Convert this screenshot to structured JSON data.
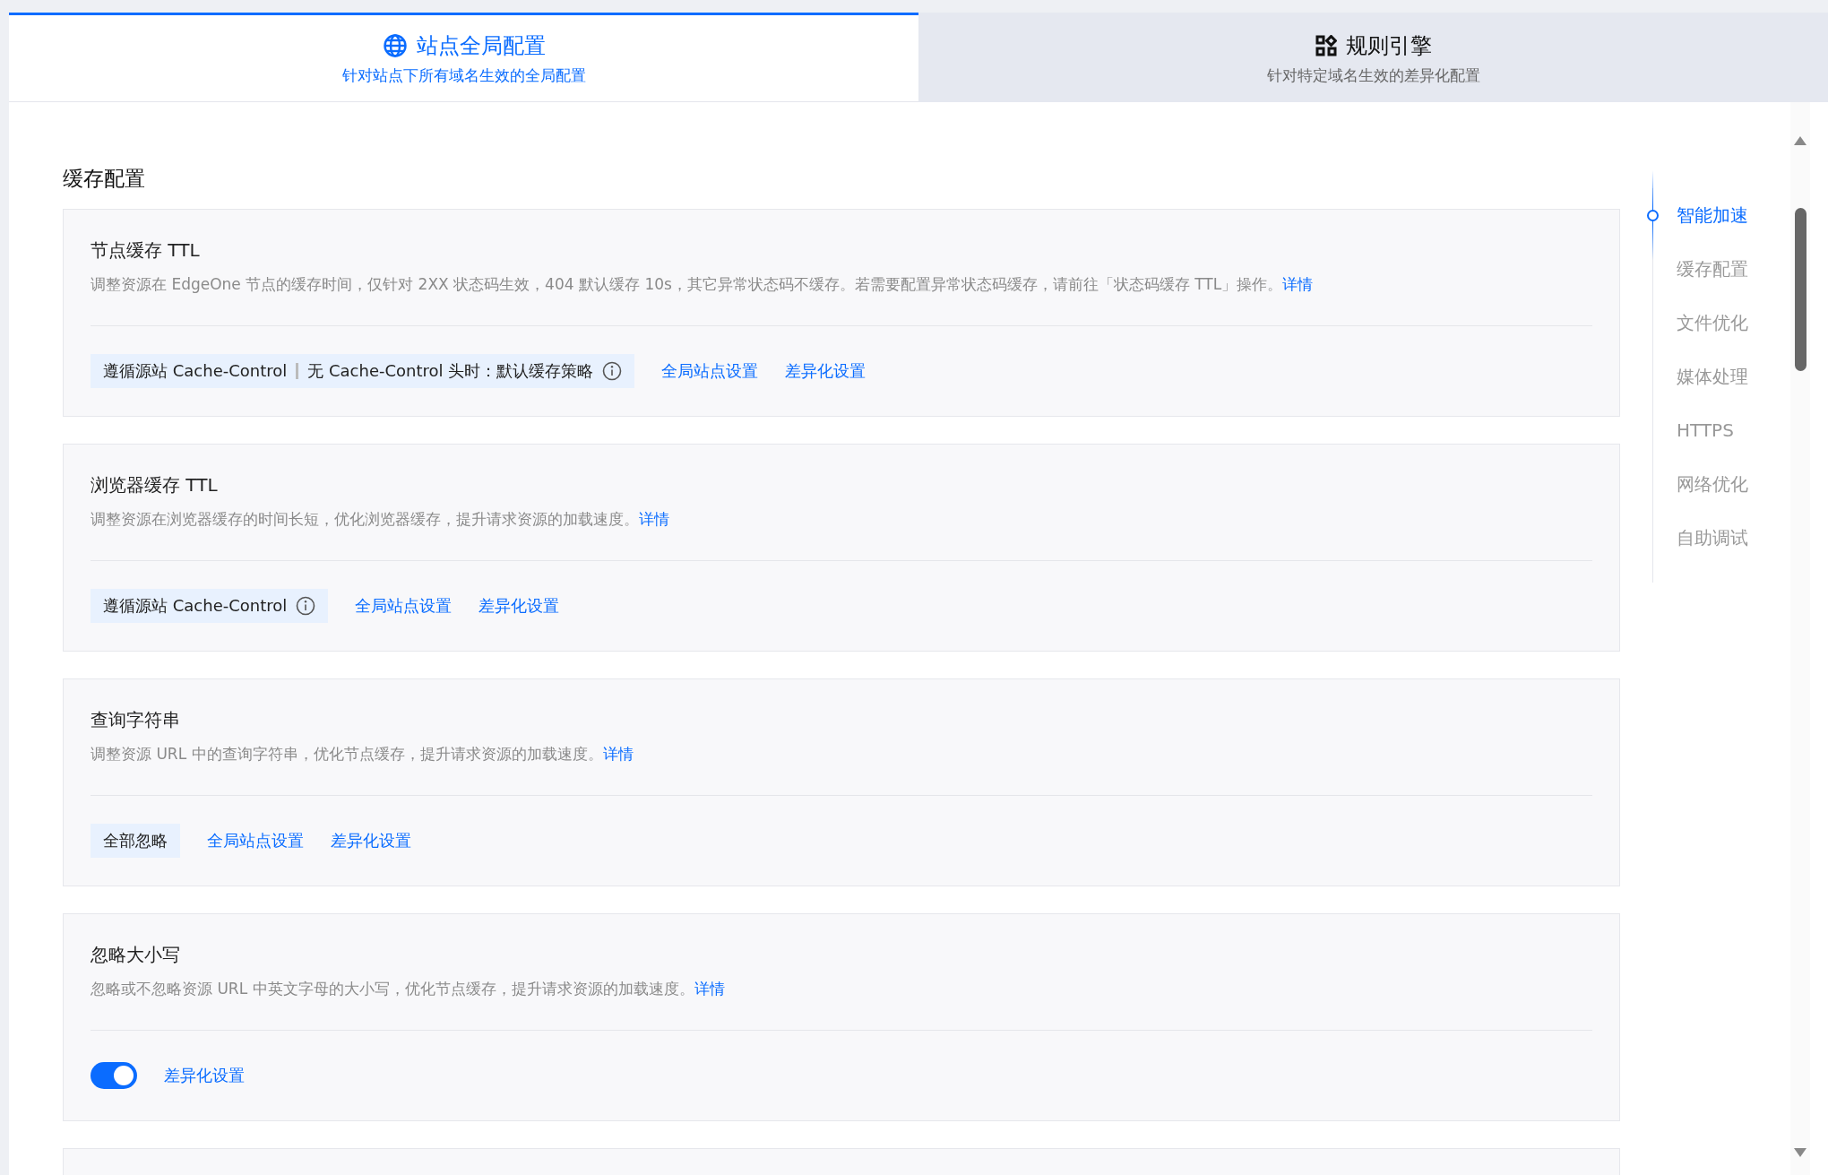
{
  "tabs": [
    {
      "kind": "globe",
      "title": "站点全局配置",
      "subtitle": "针对站点下所有域名生效的全局配置",
      "selected": true
    },
    {
      "kind": "grid",
      "title": "规则引擎",
      "subtitle": "针对特定域名生效的差异化配置",
      "selected": false
    }
  ],
  "section_title": "缓存配置",
  "cards": [
    {
      "kind": "tags",
      "title": "节点缓存 TTL",
      "description": "调整资源在 EdgeOne 节点的缓存时间，仅针对 2XX 状态码生效，404 默认缓存 10s，其它异常状态码不缓存。若需要配置异常状态码缓存，请前往「状态码缓存 TTL」操作。",
      "details_link": "详情",
      "tag_parts": [
        "遵循源站 Cache-Control",
        "无 Cache-Control 头时：默认缓存策略"
      ],
      "info": true,
      "links": [
        "全局站点设置",
        "差异化设置"
      ]
    },
    {
      "kind": "tags",
      "title": "浏览器缓存 TTL",
      "description": "调整资源在浏览器缓存的时间长短，优化浏览器缓存，提升请求资源的加载速度。",
      "details_link": "详情",
      "tag_parts": [
        "遵循源站 Cache-Control"
      ],
      "info": true,
      "links": [
        "全局站点设置",
        "差异化设置"
      ]
    },
    {
      "kind": "tags",
      "title": "查询字符串",
      "description": "调整资源 URL 中的查询字符串，优化节点缓存，提升请求资源的加载速度。",
      "details_link": "详情",
      "tag_parts": [
        "全部忽略"
      ],
      "info": false,
      "links": [
        "全局站点设置",
        "差异化设置"
      ]
    },
    {
      "kind": "toggle",
      "title": "忽略大小写",
      "description": "忽略或不忽略资源 URL 中英文字母的大小写，优化节点缓存，提升请求资源的加载速度。",
      "details_link": "详情",
      "on": true,
      "links": [
        "差异化设置"
      ]
    }
  ],
  "anchor_nav": [
    {
      "label": "智能加速",
      "selected": true
    },
    {
      "label": "缓存配置",
      "selected": false
    },
    {
      "label": "文件优化",
      "selected": false
    },
    {
      "label": "媒体处理",
      "selected": false
    },
    {
      "label": "HTTPS",
      "selected": false
    },
    {
      "label": "网络优化",
      "selected": false
    },
    {
      "label": "自助调试",
      "selected": false
    }
  ]
}
